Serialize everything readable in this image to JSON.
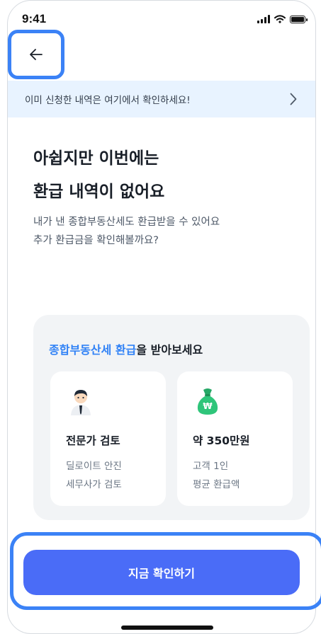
{
  "status_bar": {
    "time": "9:41"
  },
  "banner": {
    "text": "이미 신청한 내역은 여기에서 확인하세요!"
  },
  "headline": {
    "line1": "아쉽지만 이번에는",
    "line2": "환급 내역이 없어요"
  },
  "description": {
    "line1": "내가 낸 종합부동산세도 환급받을 수 있어요",
    "line2": "추가 환급금을 확인해볼까요?"
  },
  "card": {
    "title_highlight": "종합부동산세 환급",
    "title_rest": "을 받아보세요",
    "tiles": [
      {
        "icon": "tax-expert-icon",
        "title": "전문가 검토",
        "line1": "딜로이트 안진",
        "line2": "세무사가 검토"
      },
      {
        "icon": "money-bag-icon",
        "title": "약 350만원",
        "line1": "고객 1인",
        "line2": "평균 환급액"
      }
    ]
  },
  "cta": {
    "label": "지금 확인하기"
  },
  "colors": {
    "accent": "#3182f6",
    "button": "#4a6cf7",
    "highlight_frame": "#3b82f6",
    "banner_bg": "#e8f3ff",
    "card_bg": "#f2f4f6",
    "money_bag": "#2fc57a"
  }
}
